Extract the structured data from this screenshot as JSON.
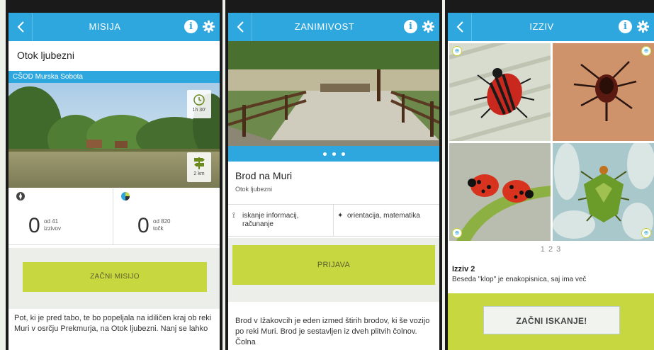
{
  "panels": {
    "mission": {
      "title": "MISIJA",
      "name": "Otok ljubezni",
      "school": "CŠOD Murska Sobota",
      "time": "1h 30'",
      "distance": "2 km",
      "challenges": {
        "value": "0",
        "label": "od 41 izzivov"
      },
      "points": {
        "value": "0",
        "label": "od 820 točk"
      },
      "start_label": "ZAČNI MISIJO",
      "description": "Pot, ki je pred tabo, te bo popeljala na idiličen kraj ob reki Muri v osrčju Prekmurja, na Otok ljubezni. Nanj se lahko"
    },
    "fact": {
      "title": "ZANIMIVOST",
      "name": "Brod na Muri",
      "sub": "Otok ljubezni",
      "tag1": "iskanje informacij, računanje",
      "tag2": "orientacija, matematika",
      "signup_label": "PRIJAVA",
      "description": "Brod v Ižakovcih je eden izmed štirih brodov, ki še vozijo po reki Muri. Brod je sestavljen iz dveh plitvih čolnov. Čolna"
    },
    "challenge": {
      "title": "IZZIV",
      "pages": "1 2 3",
      "heading": "Izziv 2",
      "text": "Beseda \"klop\" je enakopisnica, saj ima več",
      "start_label": "ZAČNI ISKANJE!"
    }
  },
  "colors": {
    "header": "#2ea7df",
    "accent": "#c6d740"
  }
}
